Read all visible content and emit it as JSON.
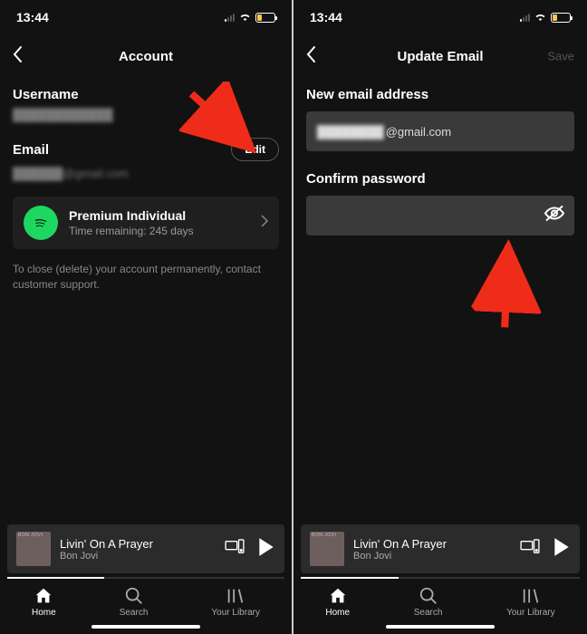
{
  "status": {
    "time": "13:44"
  },
  "left": {
    "title": "Account",
    "usernameLabel": "Username",
    "usernameValue": "████████████",
    "emailLabel": "Email",
    "emailValue": "██████@gmail.com",
    "editBtn": "Edit",
    "plan": {
      "title": "Premium Individual",
      "sub": "Time remaining: 245 days"
    },
    "closeText": "To close (delete) your account permanently, contact customer support."
  },
  "right": {
    "title": "Update Email",
    "save": "Save",
    "newEmailLabel": "New email address",
    "newEmailPrefix": "████████",
    "newEmailSuffix": "@gmail.com",
    "confirmLabel": "Confirm password"
  },
  "nowplaying": {
    "title": "Livin' On A Prayer",
    "artist": "Bon Jovi"
  },
  "tabs": {
    "home": "Home",
    "search": "Search",
    "library": "Your Library"
  }
}
